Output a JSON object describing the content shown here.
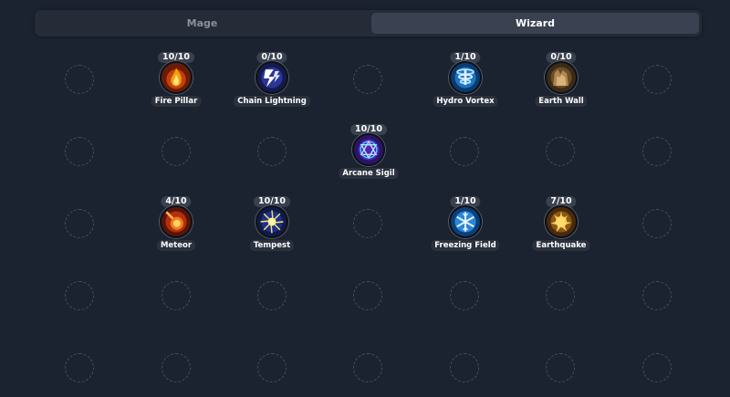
{
  "tabs": {
    "mage": "Mage",
    "wizard": "Wizard",
    "active": "Wizard"
  },
  "skills": [
    {
      "name": "Fire Pillar",
      "level": "10/10",
      "icon": "fire-pillar-icon",
      "color": "#f08a1a"
    },
    {
      "name": "Chain Lightning",
      "level": "0/10",
      "icon": "chain-lightning-icon",
      "color": "#3b4cc0"
    },
    {
      "name": "Hydro Vortex",
      "level": "1/10",
      "icon": "hydro-vortex-icon",
      "color": "#2f9be0"
    },
    {
      "name": "Earth Wall",
      "level": "0/10",
      "icon": "earth-wall-icon",
      "color": "#8a6b3d"
    },
    {
      "name": "Arcane Sigil",
      "level": "10/10",
      "icon": "arcane-sigil-icon",
      "color": "#6a3cd6"
    },
    {
      "name": "Meteor",
      "level": "4/10",
      "icon": "meteor-icon",
      "color": "#e0541a"
    },
    {
      "name": "Tempest",
      "level": "10/10",
      "icon": "tempest-icon",
      "color": "#e8d44a"
    },
    {
      "name": "Freezing Field",
      "level": "1/10",
      "icon": "freezing-field-icon",
      "color": "#4fb8ef"
    },
    {
      "name": "Earthquake",
      "level": "7/10",
      "icon": "earthquake-icon",
      "color": "#f0a020"
    }
  ]
}
